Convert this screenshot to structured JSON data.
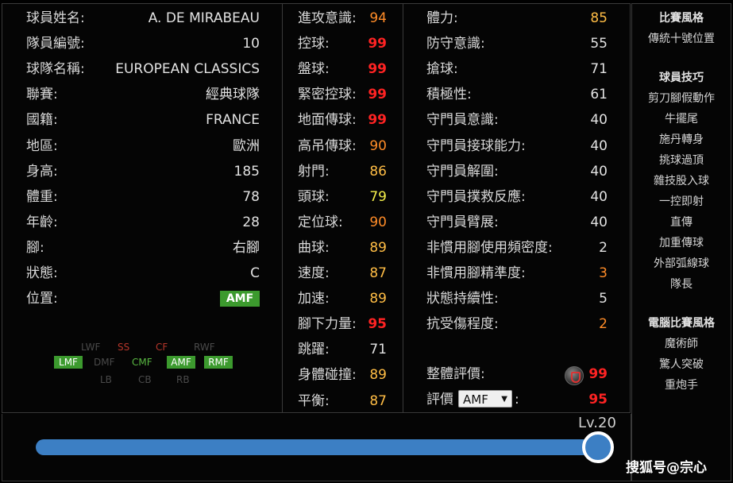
{
  "profile": [
    {
      "label": "球員姓名:",
      "value": "A. DE MIRABEAU"
    },
    {
      "label": "隊員編號:",
      "value": "10"
    },
    {
      "label": "球隊名稱:",
      "value": "EUROPEAN CLASSICS"
    },
    {
      "label": "聯賽:",
      "value": "經典球隊"
    },
    {
      "label": "國籍:",
      "value": "FRANCE"
    },
    {
      "label": "地區:",
      "value": "歐洲"
    },
    {
      "label": "身高:",
      "value": "185"
    },
    {
      "label": "體重:",
      "value": "78"
    },
    {
      "label": "年齡:",
      "value": "28"
    },
    {
      "label": "腳:",
      "value": "右腳"
    },
    {
      "label": "狀態:",
      "value": "C"
    },
    {
      "label": "位置:",
      "value": "AMF"
    }
  ],
  "positions_map": {
    "row1": [
      "LWF",
      "SS",
      "CF",
      "RWF"
    ],
    "row2": [
      "LMF",
      "DMF",
      "CMF",
      "AMF",
      "RMF"
    ],
    "row3": [
      "LB",
      "CB",
      "RB"
    ]
  },
  "stats_mid": [
    {
      "label": "進攻意識:",
      "value": "94",
      "color": "#ff8c28"
    },
    {
      "label": "控球:",
      "value": "99",
      "color": "#ff2323"
    },
    {
      "label": "盤球:",
      "value": "99",
      "color": "#ff2323"
    },
    {
      "label": "緊密控球:",
      "value": "99",
      "color": "#ff2323"
    },
    {
      "label": "地面傳球:",
      "value": "99",
      "color": "#ff2323"
    },
    {
      "label": "高吊傳球:",
      "value": "90",
      "color": "#ff8c28"
    },
    {
      "label": "射門:",
      "value": "86",
      "color": "#ffbd45"
    },
    {
      "label": "頭球:",
      "value": "79",
      "color": "#f4ef4b"
    },
    {
      "label": "定位球:",
      "value": "90",
      "color": "#ff8c28"
    },
    {
      "label": "曲球:",
      "value": "89",
      "color": "#ffbd45"
    },
    {
      "label": "速度:",
      "value": "87",
      "color": "#ffbd45"
    },
    {
      "label": "加速:",
      "value": "89",
      "color": "#ffbd45"
    },
    {
      "label": "腳下力量:",
      "value": "95",
      "color": "#ff2323"
    },
    {
      "label": "跳躍:",
      "value": "71",
      "color": "#e2e2e2"
    },
    {
      "label": "身體碰撞:",
      "value": "89",
      "color": "#ffbd45"
    },
    {
      "label": "平衡:",
      "value": "87",
      "color": "#ffbd45"
    }
  ],
  "stats_right": [
    {
      "label": "體力:",
      "value": "85",
      "color": "#ffbd45"
    },
    {
      "label": "防守意識:",
      "value": "55",
      "color": "#e2e2e2"
    },
    {
      "label": "搶球:",
      "value": "71",
      "color": "#e2e2e2"
    },
    {
      "label": "積極性:",
      "value": "61",
      "color": "#e2e2e2"
    },
    {
      "label": "守門員意識:",
      "value": "40",
      "color": "#e2e2e2"
    },
    {
      "label": "守門員接球能力:",
      "value": "40",
      "color": "#e2e2e2"
    },
    {
      "label": "守門員解圍:",
      "value": "40",
      "color": "#e2e2e2"
    },
    {
      "label": "守門員撲救反應:",
      "value": "40",
      "color": "#e2e2e2"
    },
    {
      "label": "守門員臂展:",
      "value": "40",
      "color": "#e2e2e2"
    },
    {
      "label": "非慣用腳使用頻密度:",
      "value": "2",
      "color": "#e2e2e2"
    },
    {
      "label": "非慣用腳精準度:",
      "value": "3",
      "color": "#ff8c28"
    },
    {
      "label": "狀態持續性:",
      "value": "5",
      "color": "#e2e2e2"
    },
    {
      "label": "抗受傷程度:",
      "value": "2",
      "color": "#ff8c28"
    }
  ],
  "overall": {
    "label": "整體評價:",
    "value": "99",
    "color": "#ff2323"
  },
  "rating": {
    "label": "評價",
    "select": "AMF",
    "suffix": ":",
    "value": "95",
    "color": "#ff2323"
  },
  "right_panel": {
    "playing_style_title": "比賽風格",
    "playing_style": "傳統十號位置",
    "skills_title": "球員技巧",
    "skills": [
      "剪刀腳假動作",
      "牛擺尾",
      "施丹轉身",
      "挑球過頂",
      "雜技股入球",
      "一控即射",
      "直傳",
      "加重傳球",
      "外部弧線球",
      "隊長"
    ],
    "com_style_title": "電腦比賽風格",
    "com_styles": [
      "魔術師",
      "驚人突破",
      "重炮手"
    ]
  },
  "level": {
    "label": "Lv.20",
    "fraction": 1.0
  },
  "watermark": "搜狐号@宗心",
  "colors": {
    "accent": "#3c7fc4",
    "position_badge": "#3c9a2e"
  },
  "icons": {
    "overall_badge": "shield-badge-icon",
    "select_arrow": "chevron-down-icon"
  }
}
